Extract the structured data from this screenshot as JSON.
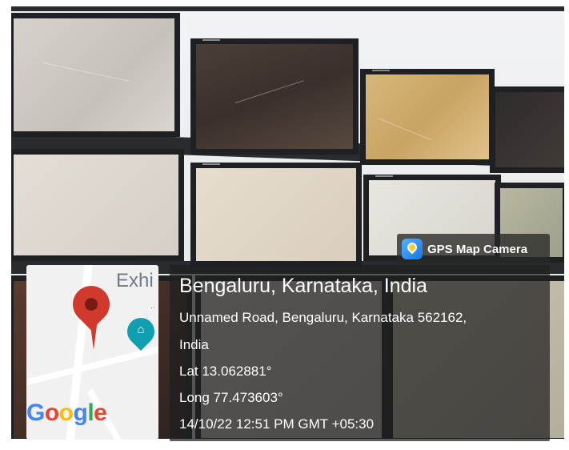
{
  "badge": {
    "app_name": "GPS Map Camera",
    "icon": "gps-map-camera-icon"
  },
  "location": {
    "city": "Bengaluru, Karnataka, India",
    "address_line1": "Unnamed Road, Bengaluru, Karnataka 562162,",
    "address_line2": "India",
    "lat": "Lat 13.062881°",
    "long": "Long 77.473603°",
    "timestamp": "14/10/22 12:51 PM GMT +05:30"
  },
  "map": {
    "label": "Exhi",
    "dots": "..",
    "brand": {
      "g1": "G",
      "g2": "o",
      "g3": "o",
      "g4": "g",
      "g5": "l",
      "g6": "e"
    },
    "pin_icon": "location-pin-icon",
    "poi_icon": "museum-icon"
  },
  "colors": {
    "pin": "#d0392b",
    "poi": "#0f9fb0",
    "card_bg": "rgba(30,30,30,0.72)"
  }
}
